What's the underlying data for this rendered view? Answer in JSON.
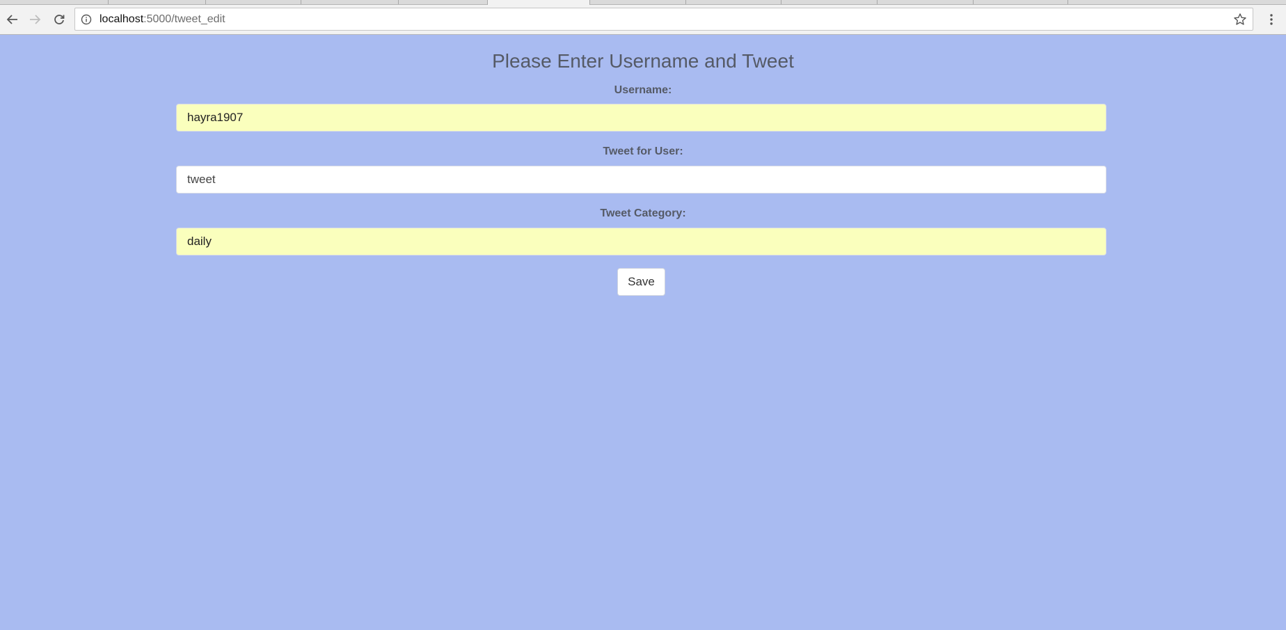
{
  "browser": {
    "url_host": "localhost",
    "url_path": ":5000/tweet_edit"
  },
  "form": {
    "title": "Please Enter Username and Tweet",
    "username_label": "Username:",
    "username_value": "hayra1907",
    "tweet_label": "Tweet for User:",
    "tweet_value": "tweet",
    "category_label": "Tweet Category:",
    "category_value": "daily",
    "save_label": "Save"
  },
  "colors": {
    "page_background": "#a9bbf1",
    "autofill_background": "#faffbd"
  }
}
